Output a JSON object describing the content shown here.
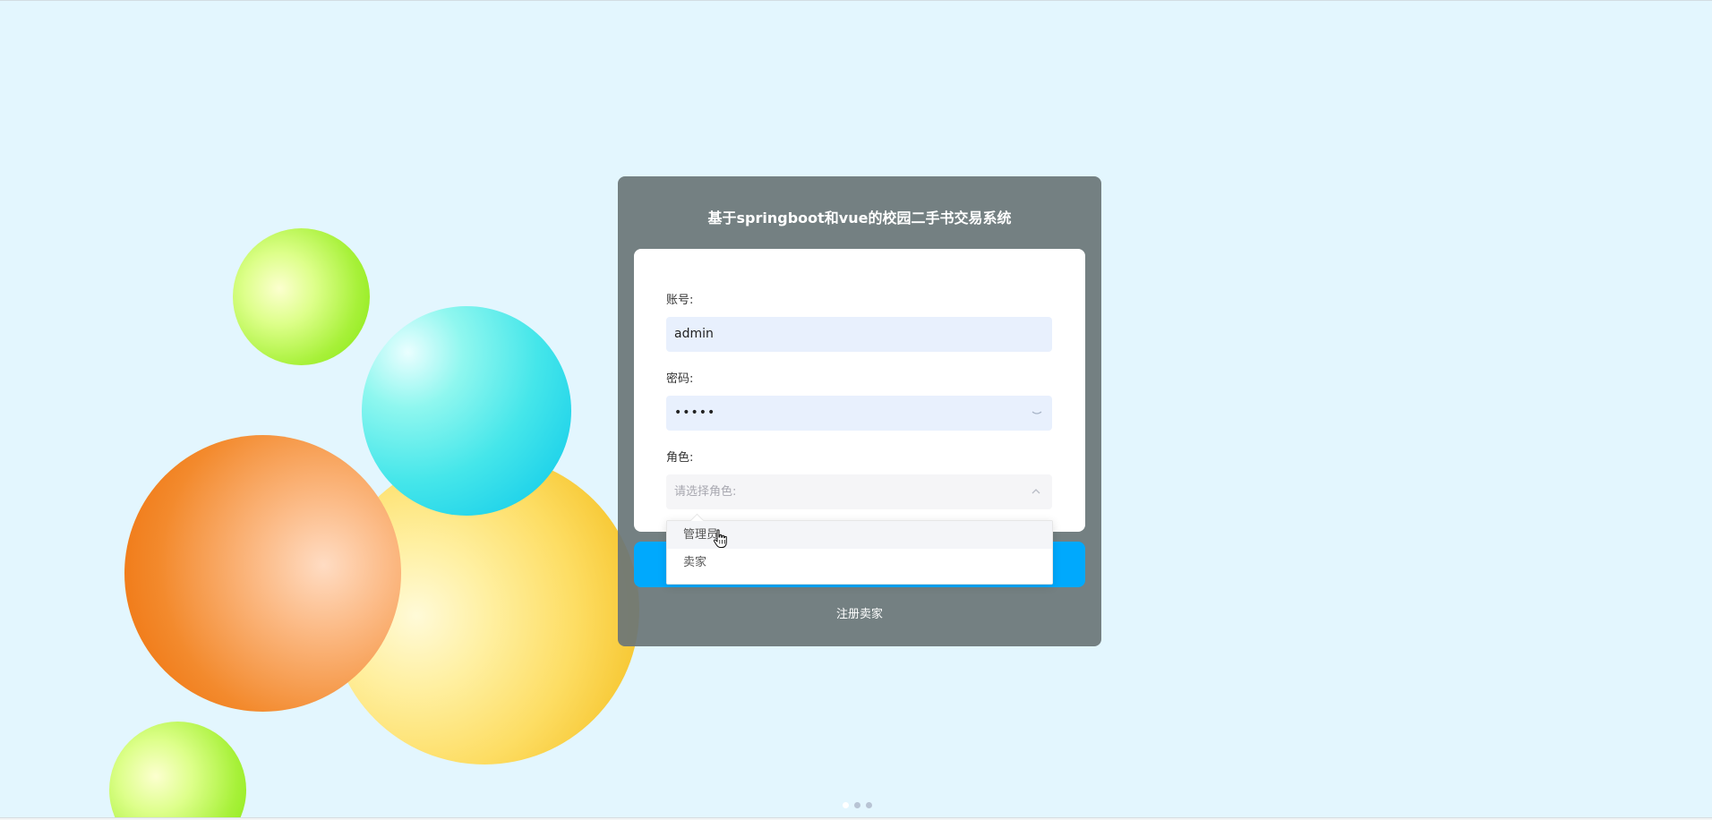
{
  "system_title": "基于springboot和vue的校园二手书交易系统",
  "form": {
    "username_label": "账号:",
    "username_value": "admin",
    "password_label": "密码:",
    "password_value": "•••••",
    "role_label": "角色:",
    "role_placeholder": "请选择角色:"
  },
  "dropdown": {
    "options": [
      "管理员",
      "卖家"
    ]
  },
  "register_link": "注册卖家",
  "carousel": {
    "dot_count": 3
  },
  "colors": {
    "background": "#e3f6fe",
    "panel": "#6a7577",
    "login_button": "#00a9fd",
    "input_bg": "#e8f0fd"
  },
  "icons": {
    "password_toggle": "eye-icon",
    "select_chevron": "chevron-up-icon",
    "cursor": "pointer-hand-icon"
  }
}
